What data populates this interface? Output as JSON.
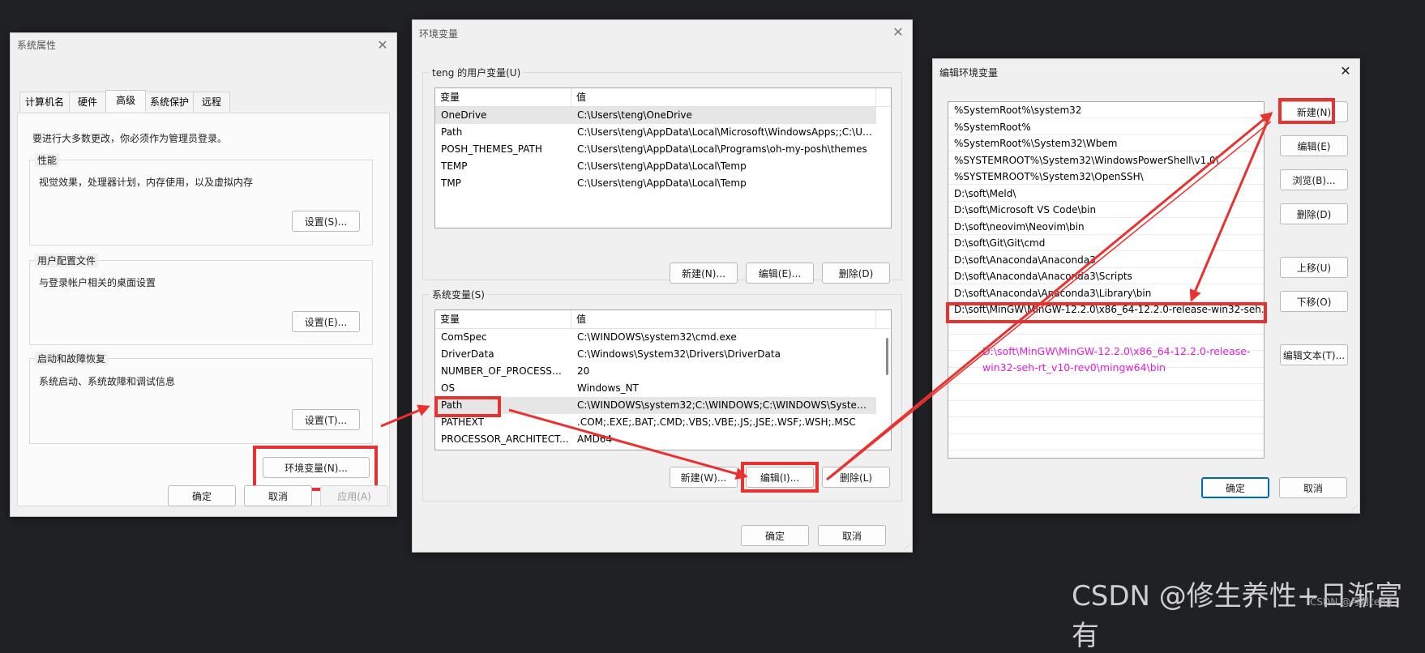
{
  "colors": {
    "highlight": "#e8322f",
    "note": "#e11fd8",
    "background": "#202124"
  },
  "sysprops": {
    "title": "系统属性",
    "tabs": [
      "计算机名",
      "硬件",
      "高级",
      "系统保护",
      "远程"
    ],
    "admin_note": "要进行大多数更改，你必须作为管理员登录。",
    "performance": {
      "label": "性能",
      "desc": "视觉效果，处理器计划，内存使用，以及虚拟内存",
      "button": "设置(S)..."
    },
    "profile": {
      "label": "用户配置文件",
      "desc": "与登录帐户相关的桌面设置",
      "button": "设置(E)..."
    },
    "startup": {
      "label": "启动和故障恢复",
      "desc": "系统启动、系统故障和调试信息",
      "button": "设置(T)..."
    },
    "env_button": "环境变量(N)...",
    "ok": "确定",
    "cancel": "取消",
    "apply": "应用(A)"
  },
  "envvars": {
    "title": "环境变量",
    "user_group_label": "teng 的用户变量(U)",
    "col_var": "变量",
    "col_val": "值",
    "user_vars": [
      {
        "name": "OneDrive",
        "value": "C:\\Users\\teng\\OneDrive"
      },
      {
        "name": "Path",
        "value": "C:\\Users\\teng\\AppData\\Local\\Microsoft\\WindowsApps;;C:\\Us..."
      },
      {
        "name": "POSH_THEMES_PATH",
        "value": "C:\\Users\\teng\\AppData\\Local\\Programs\\oh-my-posh\\themes"
      },
      {
        "name": "TEMP",
        "value": "C:\\Users\\teng\\AppData\\Local\\Temp"
      },
      {
        "name": "TMP",
        "value": "C:\\Users\\teng\\AppData\\Local\\Temp"
      }
    ],
    "user_new": "新建(N)...",
    "user_edit": "编辑(E)...",
    "user_delete": "删除(D)",
    "sys_group_label": "系统变量(S)",
    "sys_vars": [
      {
        "name": "ComSpec",
        "value": "C:\\WINDOWS\\system32\\cmd.exe"
      },
      {
        "name": "DriverData",
        "value": "C:\\Windows\\System32\\Drivers\\DriverData"
      },
      {
        "name": "NUMBER_OF_PROCESSORS",
        "value": "20"
      },
      {
        "name": "OS",
        "value": "Windows_NT"
      },
      {
        "name": "Path",
        "value": "C:\\WINDOWS\\system32;C:\\WINDOWS;C:\\WINDOWS\\System..."
      },
      {
        "name": "PATHEXT",
        "value": ".COM;.EXE;.BAT;.CMD;.VBS;.VBE;.JS;.JSE;.WSF;.WSH;.MSC"
      },
      {
        "name": "PROCESSOR_ARCHITECT...",
        "value": "AMD64"
      }
    ],
    "sys_new": "新建(W)...",
    "sys_edit": "编辑(I)...",
    "sys_delete": "删除(L)",
    "ok": "确定",
    "cancel": "取消"
  },
  "editenv": {
    "title": "编辑环境变量",
    "entries": [
      "%SystemRoot%\\system32",
      "%SystemRoot%",
      "%SystemRoot%\\System32\\Wbem",
      "%SYSTEMROOT%\\System32\\WindowsPowerShell\\v1.0\\",
      "%SYSTEMROOT%\\System32\\OpenSSH\\",
      "D:\\soft\\Meld\\",
      "D:\\soft\\Microsoft VS Code\\bin",
      "D:\\soft\\neovim\\Neovim\\bin",
      "D:\\soft\\Git\\Git\\cmd",
      "D:\\soft\\Anaconda\\Anaconda3",
      "D:\\soft\\Anaconda\\Anaconda3\\Scripts",
      "D:\\soft\\Anaconda\\Anaconda3\\Library\\bin",
      "D:\\soft\\MinGW\\MinGW-12.2.0\\x86_64-12.2.0-release-win32-seh..."
    ],
    "note_line1": "D:\\soft\\MinGW\\MinGW-12.2.0\\x86_64-12.2.0-release-",
    "note_line2": "win32-seh-rt_v10-rev0\\mingw64\\bin",
    "btn_new": "新建(N)",
    "btn_edit": "编辑(E)",
    "btn_browse": "浏览(B)...",
    "btn_delete": "删除(D)",
    "btn_up": "上移(U)",
    "btn_down": "下移(O)",
    "btn_edit_text": "编辑文本(T)...",
    "ok": "确定",
    "cancel": "取消"
  },
  "watermark": {
    "main": "CSDN @修生养性+日渐富有",
    "small": "CSDN @月月teng"
  }
}
